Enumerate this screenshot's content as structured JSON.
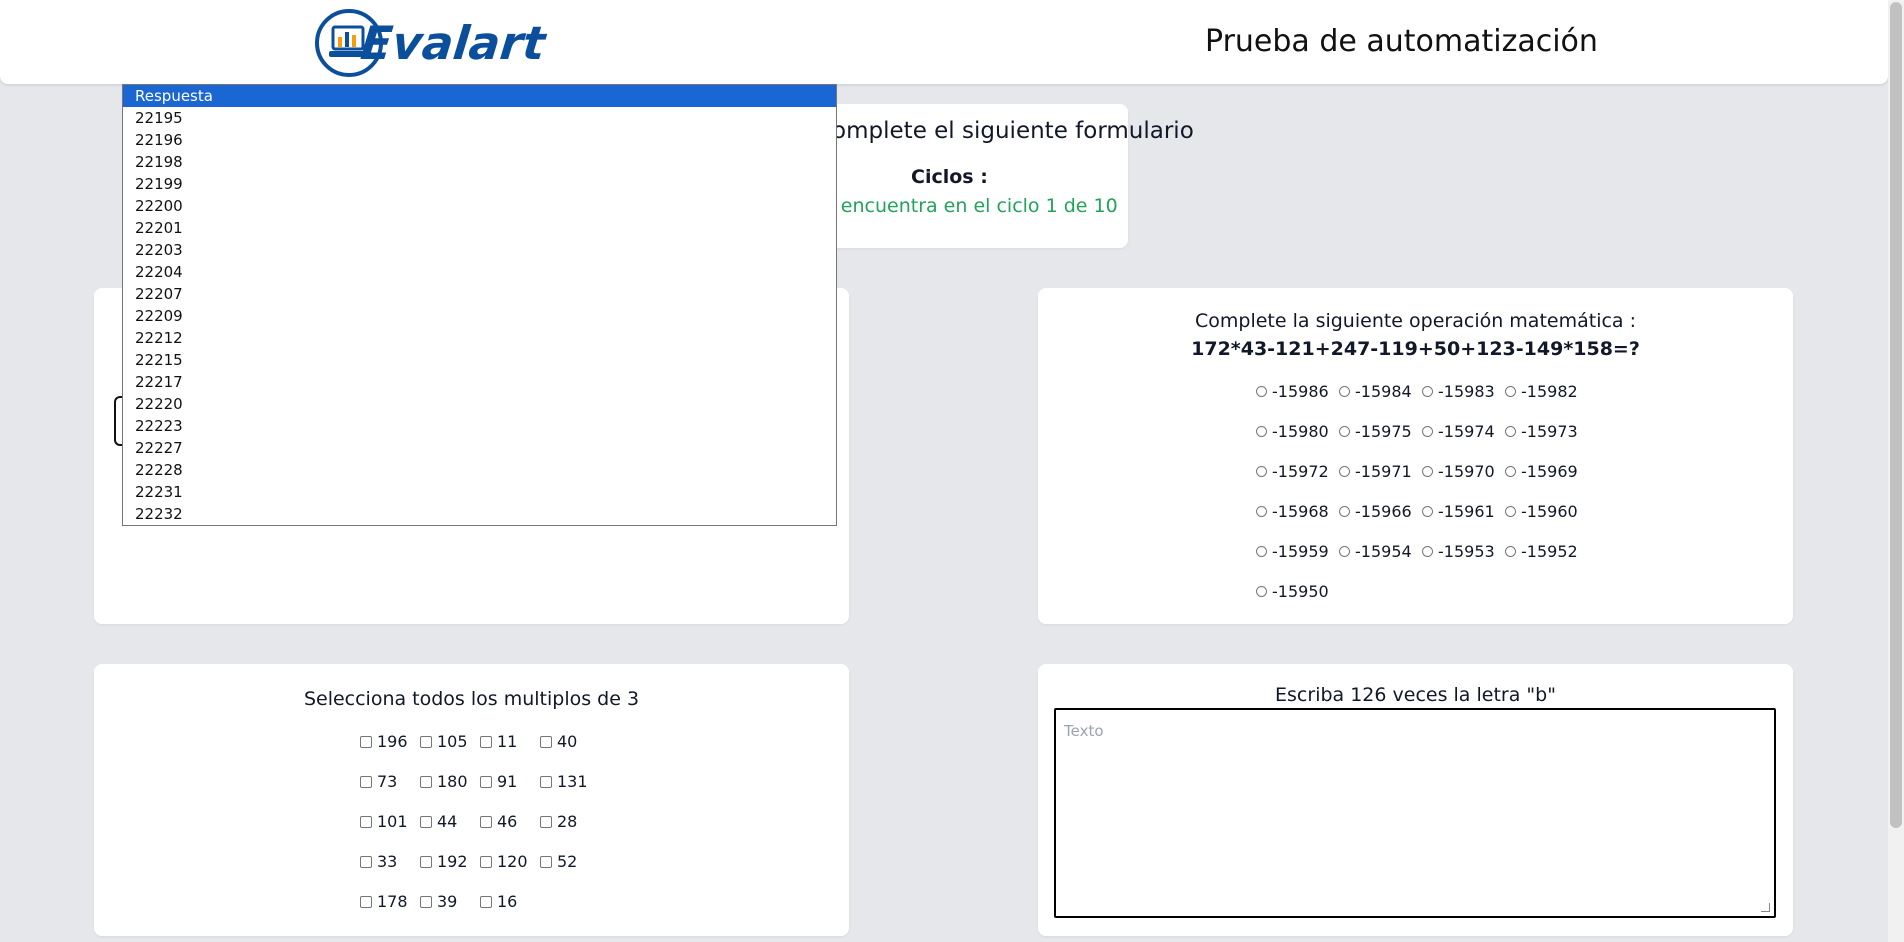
{
  "header": {
    "logo_text": "Evalart",
    "title": "Prueba de automatización"
  },
  "cycle": {
    "intro": "Complete el siguiente formulario",
    "cycles_label": "Ciclos :",
    "status": "Se encuentra en el ciclo 1 de 10"
  },
  "dropdown": {
    "selected": "Respuesta",
    "options": [
      "Respuesta",
      "22195",
      "22196",
      "22198",
      "22199",
      "22200",
      "22201",
      "22203",
      "22204",
      "22207",
      "22209",
      "22212",
      "22215",
      "22217",
      "22220",
      "22223",
      "22227",
      "22228",
      "22231",
      "22232"
    ]
  },
  "math": {
    "question": "Complete la siguiente operación matemática :",
    "expression": "172*43-121+247-119+50+123-149*158=?",
    "options": [
      "-15986",
      "-15984",
      "-15983",
      "-15982",
      "-15980",
      "-15975",
      "-15974",
      "-15973",
      "-15972",
      "-15971",
      "-15970",
      "-15969",
      "-15968",
      "-15966",
      "-15961",
      "-15960",
      "-15959",
      "-15954",
      "-15953",
      "-15952",
      "-15950"
    ]
  },
  "multiples": {
    "question": "Selecciona todos los multiplos de 3",
    "options": [
      "196",
      "105",
      "11",
      "40",
      "73",
      "180",
      "91",
      "131",
      "101",
      "44",
      "46",
      "28",
      "33",
      "192",
      "120",
      "52",
      "178",
      "39",
      "16"
    ]
  },
  "text_task": {
    "question": "Escriba 126 veces la letra \"b\"",
    "placeholder": "Texto"
  },
  "colors": {
    "accent": "#1a66d2",
    "success": "#22a35a",
    "logo": "#0b4f9c"
  }
}
